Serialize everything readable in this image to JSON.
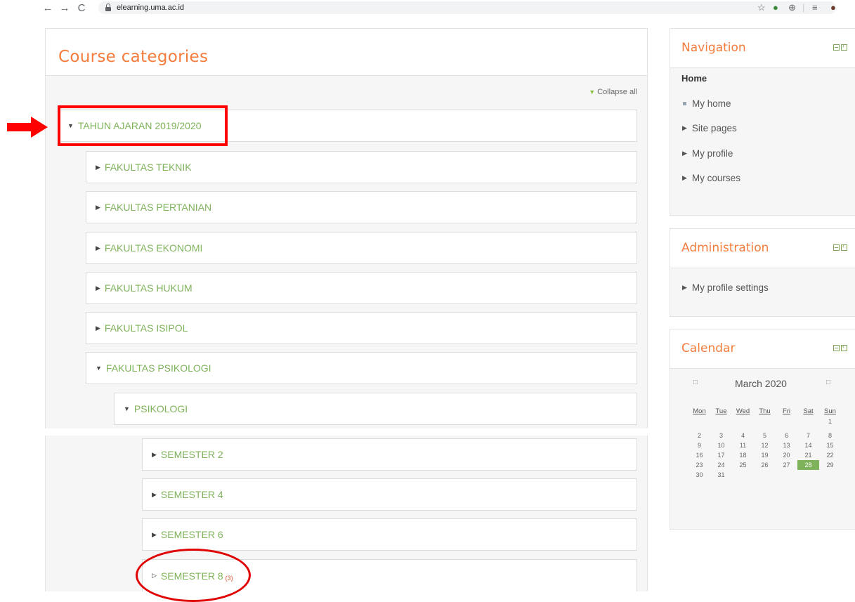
{
  "browser": {
    "url": "elearning.uma.ac.id",
    "back_icon": "←",
    "forward_icon": "→",
    "reload_icon": "C"
  },
  "page": {
    "title": "Course categories",
    "collapse_all": "Collapse all"
  },
  "categories": {
    "tahun_ajaran": "TAHUN AJARAN 2019/2020",
    "teknik": "FAKULTAS TEKNIK",
    "pertanian": "FAKULTAS PERTANIAN",
    "ekonomi": "FAKULTAS EKONOMI",
    "hukum": "FAKULTAS HUKUM",
    "isipol": "FAKULTAS ISIPOL",
    "psikologi": "FAKULTAS PSIKOLOGI",
    "psikologi_sub": "PSIKOLOGI",
    "semester2": "SEMESTER 2",
    "semester4": "SEMESTER 4",
    "semester6": "SEMESTER 6",
    "semester8": "SEMESTER 8",
    "semester8_count": "(3)"
  },
  "navigation": {
    "title": "Navigation",
    "home": "Home",
    "my_home": "My home",
    "site_pages": "Site pages",
    "my_profile": "My profile",
    "my_courses": "My courses"
  },
  "administration": {
    "title": "Administration",
    "my_profile_settings": "My profile settings"
  },
  "calendar": {
    "title": "Calendar",
    "month": "March 2020",
    "days": [
      "Mon",
      "Tue",
      "Wed",
      "Thu",
      "Fri",
      "Sat",
      "Sun"
    ],
    "today": "28"
  },
  "colors": {
    "accent_orange": "#f47c3c",
    "link_green": "#7fb35b",
    "annotation_red": "#ff0000"
  }
}
